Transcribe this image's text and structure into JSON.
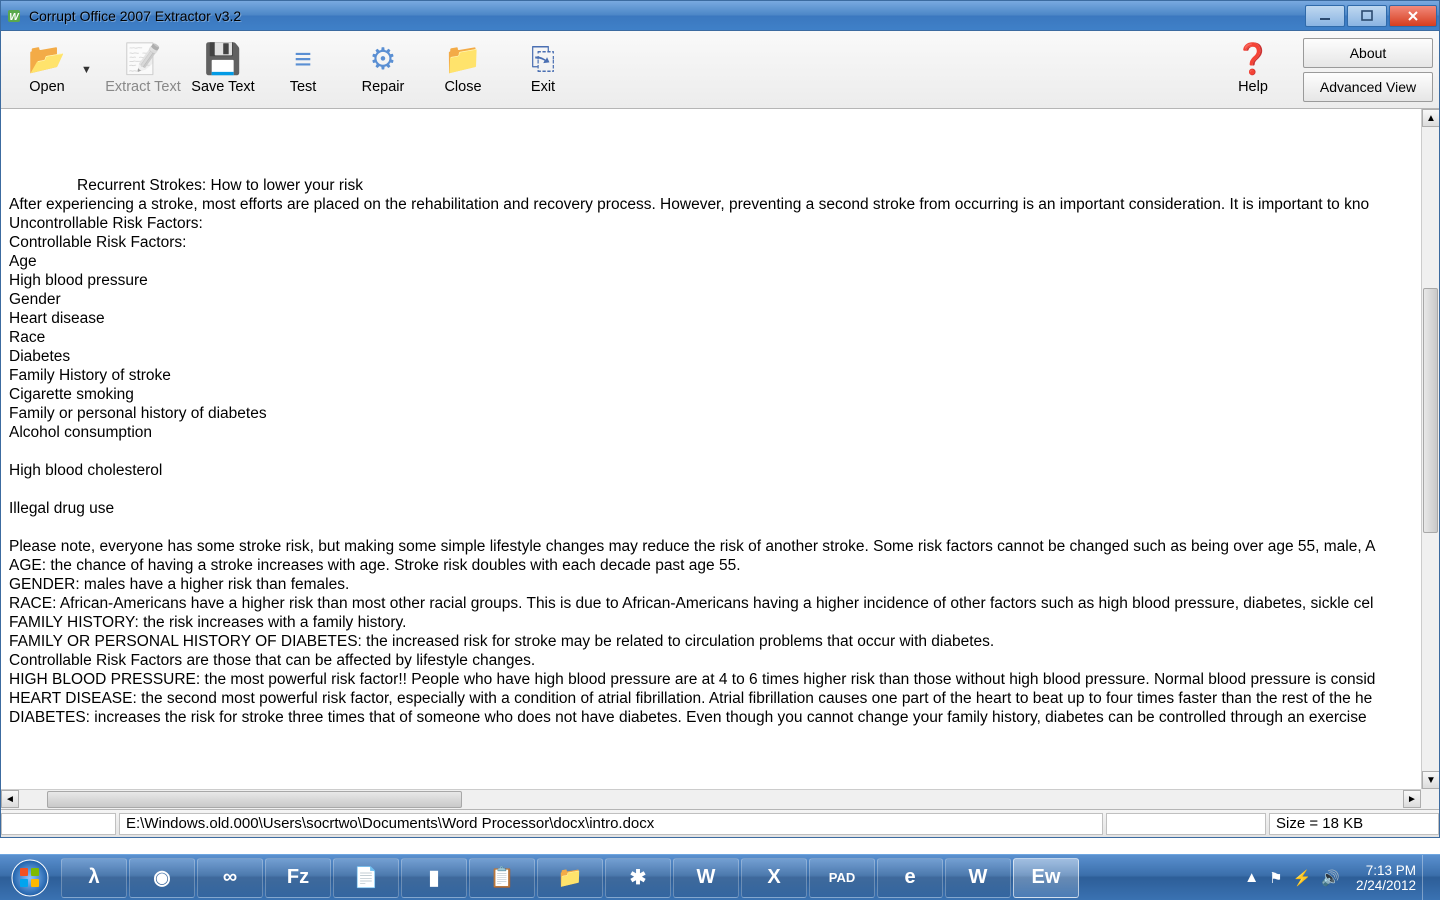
{
  "titlebar": {
    "title": "Corrupt Office 2007 Extractor v3.2"
  },
  "toolbar": {
    "open": "Open",
    "extract": "Extract Text",
    "save": "Save Text",
    "test": "Test",
    "repair": "Repair",
    "close": "Close",
    "exit": "Exit",
    "help": "Help",
    "about": "About",
    "advanced": "Advanced View"
  },
  "document": {
    "indented_title": "Recurrent Strokes: How to lower your risk",
    "lines": [
      "After experiencing a stroke, most efforts are placed on the rehabilitation and recovery process. However, preventing a second stroke from occurring is an important consideration. It is important to kno",
      "Uncontrollable Risk Factors:",
      "Controllable Risk Factors:",
      "Age",
      "High blood pressure",
      "Gender",
      "Heart disease",
      "Race",
      "Diabetes",
      "Family History of stroke",
      "Cigarette smoking",
      "Family or personal history of diabetes",
      "Alcohol consumption",
      "",
      "High blood cholesterol",
      "",
      "Illegal drug use",
      "",
      "Please note, everyone has some stroke risk, but making some simple lifestyle changes may reduce the risk of another stroke. Some risk factors cannot be changed such as being over age 55, male, A",
      "AGE: the chance of having a stroke increases with age. Stroke risk doubles with each decade past age 55.",
      "GENDER: males have a higher risk than females.",
      "RACE: African-Americans have a higher risk than most other racial groups. This is due to African-Americans having a higher incidence of other factors such as high blood pressure, diabetes, sickle cel",
      "FAMILY HISTORY: the risk increases with a family history.",
      "FAMILY OR PERSONAL HISTORY OF DIABETES: the increased risk for stroke may be related to circulation problems that occur with diabetes.",
      "Controllable Risk Factors are those that can be affected by lifestyle changes.",
      "HIGH BLOOD PRESSURE: the most powerful risk factor!! People who have high blood pressure are at 4 to 6 times higher risk than those without high blood pressure. Normal blood pressure is consid",
      "HEART DISEASE: the second most powerful risk factor, especially with a condition of atrial fibrillation. Atrial fibrillation causes one part of the heart to beat up to four times faster than the rest of the he",
      "DIABETES: increases the risk for stroke three times that of someone who does not have diabetes. Even though you cannot change your family history, diabetes can be controlled through an exercise"
    ]
  },
  "statusbar": {
    "path": "E:\\Windows.old.000\\Users\\socrtwo\\Documents\\Word Processor\\docx\\intro.docx",
    "size": "Size = 18 KB"
  },
  "tray": {
    "time": "7:13 PM",
    "date": "2/24/2012"
  },
  "icons": {
    "open_glyph": "📂",
    "save_glyph": "💾",
    "test_glyph": "✓",
    "repair_glyph": "🛠",
    "close_glyph": "📄",
    "exit_glyph": "🚪",
    "help_glyph": "❓",
    "extract_glyph": "📝"
  },
  "taskbar_items": [
    {
      "name": "lambda",
      "glyph": "λ"
    },
    {
      "name": "chrome",
      "glyph": "◉"
    },
    {
      "name": "visualstudio",
      "glyph": "∞"
    },
    {
      "name": "filezilla",
      "glyph": "Fz"
    },
    {
      "name": "notepad",
      "glyph": "📄"
    },
    {
      "name": "cmd",
      "glyph": "▮"
    },
    {
      "name": "notepadpp",
      "glyph": "📋"
    },
    {
      "name": "explorer",
      "glyph": "📁"
    },
    {
      "name": "app-red",
      "glyph": "✱"
    },
    {
      "name": "word",
      "glyph": "W"
    },
    {
      "name": "excel",
      "glyph": "X"
    },
    {
      "name": "padgen",
      "glyph": "PAD"
    },
    {
      "name": "ie",
      "glyph": "e"
    },
    {
      "name": "app-green",
      "glyph": "W"
    },
    {
      "name": "extractor",
      "glyph": "Ew"
    }
  ]
}
